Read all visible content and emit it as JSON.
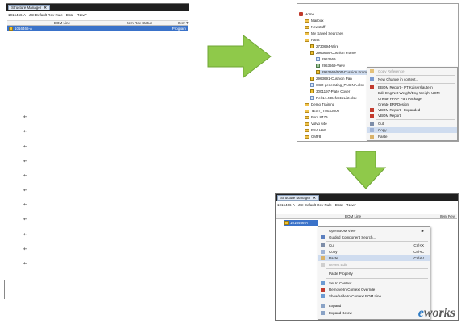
{
  "panel1": {
    "tab_label": "Structure Manager",
    "close_glyph": "✕",
    "rule_text": "1016466-A - JCI Default Rev Rule - Date - \"Now\"",
    "columns": [
      "BOM Line",
      "Item Rev Status",
      "Item T"
    ],
    "selected_row": {
      "label": "1016466-A",
      "type": "Program"
    }
  },
  "panel2": {
    "tree": [
      "Home",
      "Mailbox",
      "Newstuff",
      "My Saved Searches",
      "Parts",
      "2730694-Wire",
      "2963669-Cushion Frame",
      "2963669",
      "2963669-View",
      "2963669/000-Cushion Frame",
      "2963691-Cushion Pan",
      "SCR generating_PLC NA.xlsx",
      "3001197-Plate Cover",
      "Rel 14.4 Defects List.xlsx",
      "Demo Training",
      "TEST_Track3000",
      "Ford 8479",
      "Volvo 64e",
      "PSA HAB",
      "CMF8"
    ],
    "menu": [
      {
        "label": "Copy Reference",
        "icon": "copy-ref-icon",
        "disabled": true
      },
      {
        "label": "New Change in context...",
        "icon": "change-icon"
      },
      {
        "label": "EBOM Report - PT Kaiserslautern",
        "icon": "report-icon"
      },
      {
        "label": "Edit Eng Net Weight/Eng Weight UOM",
        "icon": "blank"
      },
      {
        "label": "Create PPAP Part Package",
        "icon": "blank"
      },
      {
        "label": "Create ERPDesign",
        "icon": "blank"
      },
      {
        "label": "VBOM Report - Expanded",
        "icon": "report-icon"
      },
      {
        "label": "VBOM Report",
        "icon": "report-icon"
      },
      {
        "label": "Cut",
        "icon": "cut-icon"
      },
      {
        "label": "Copy",
        "icon": "copy-icon"
      },
      {
        "label": "Paste",
        "icon": "paste-icon"
      }
    ]
  },
  "panel3": {
    "tab_label": "Structure Manager",
    "close_glyph": "✕",
    "rule_text": "1016466-A - JCI Default Rev Rule - Date - \"Now\"",
    "columns": [
      "BOM Line",
      "Item Rev"
    ],
    "selected_row": {
      "label": "1016466-A"
    },
    "menu": [
      {
        "label": "Open BOM View",
        "shortcut": "",
        "submenu": true
      },
      {
        "label": "Guided Component Search...",
        "shortcut": ""
      },
      {
        "label": "Cut",
        "shortcut": "Ctrl+X"
      },
      {
        "label": "Copy",
        "shortcut": "Ctrl+C"
      },
      {
        "label": "Paste",
        "shortcut": "Ctrl+V"
      },
      {
        "label": "Revert Edit",
        "shortcut": "",
        "disabled": true
      },
      {
        "label": "Paste Property",
        "shortcut": ""
      },
      {
        "label": "Set In Context",
        "shortcut": ""
      },
      {
        "label": "Remove In-Context Override",
        "shortcut": ""
      },
      {
        "label": "Show/Hide In-Context BOM Line",
        "shortcut": ""
      },
      {
        "label": "Expand",
        "shortcut": ""
      },
      {
        "label": "Expand Below",
        "shortcut": ""
      }
    ]
  },
  "paragraph_mark": "↵",
  "watermark": {
    "prefix": "e",
    "rest": "works"
  },
  "colors": {
    "arrow": "#8fc94a",
    "selection": "#3a72c9",
    "tabbar": "#1f1f1f"
  }
}
